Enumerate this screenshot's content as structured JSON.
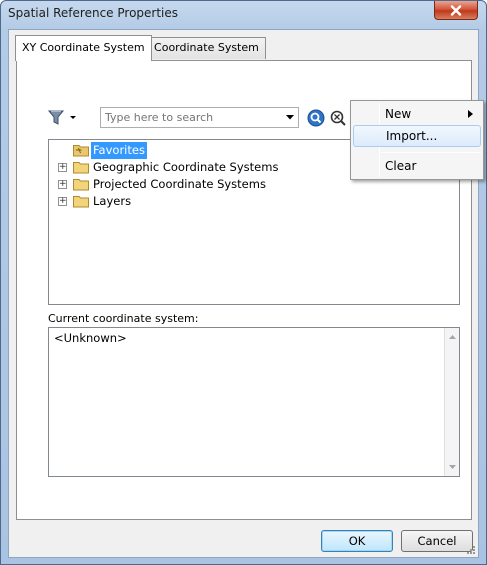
{
  "window": {
    "title": "Spatial Reference Properties"
  },
  "tabs": [
    {
      "label": "XY Coordinate System",
      "active": true
    },
    {
      "label": "Z Coordinate System",
      "active": false
    }
  ],
  "toolbar": {
    "search_placeholder": "Type here to search",
    "icons": [
      "filter-icon",
      "search-icon",
      "clear-search-icon",
      "globe-icon",
      "add-favorite-icon"
    ]
  },
  "tree": {
    "items": [
      {
        "label": "Favorites",
        "selected": true,
        "expandable": false
      },
      {
        "label": "Geographic Coordinate Systems",
        "selected": false,
        "expandable": true
      },
      {
        "label": "Projected Coordinate Systems",
        "selected": false,
        "expandable": true
      },
      {
        "label": "Layers",
        "selected": false,
        "expandable": true
      }
    ]
  },
  "current": {
    "label": "Current coordinate system:",
    "value": "<Unknown>"
  },
  "buttons": {
    "ok": "OK",
    "cancel": "Cancel"
  },
  "context_menu": {
    "items": [
      {
        "label": "New",
        "has_submenu": true
      },
      {
        "label": "Import...",
        "highlighted": true
      },
      {
        "label": "Clear"
      }
    ]
  },
  "colors": {
    "selection": "#3399ff",
    "title_bar": "#b3cbe6",
    "close_button": "#c0391a"
  }
}
